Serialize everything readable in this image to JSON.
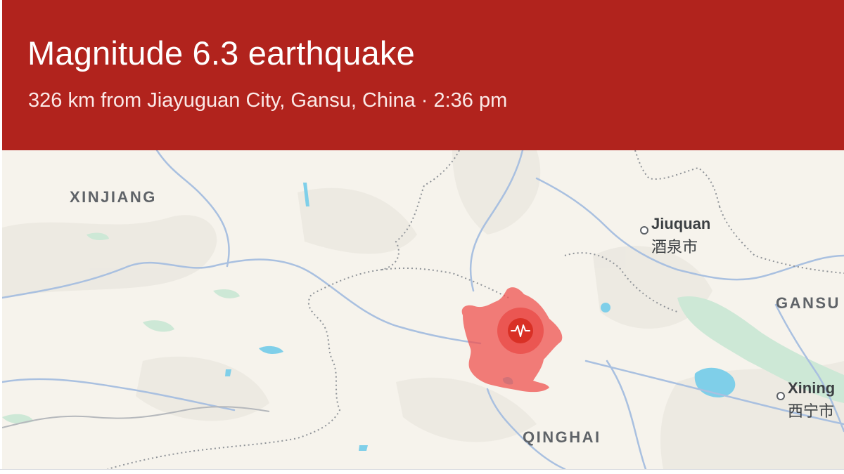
{
  "header": {
    "title": "Magnitude 6.3 earthquake",
    "subtitle": "326 km from Jiayuguan City, Gansu, China · 2:36 pm",
    "background_color": "#b1231d"
  },
  "map": {
    "regions": {
      "xinjiang": "XINJIANG",
      "gansu": "GANSU",
      "qinghai": "QINGHAI"
    },
    "cities": {
      "jiuquan": {
        "name": "Jiuquan",
        "local_name": "酒泉市"
      },
      "xining": {
        "name": "Xining",
        "local_name": "西宁市"
      }
    },
    "epicenter": {
      "icon": "seismograph-icon",
      "shaking_area_color": "#ef5350",
      "marker_color": "#d93025"
    }
  }
}
